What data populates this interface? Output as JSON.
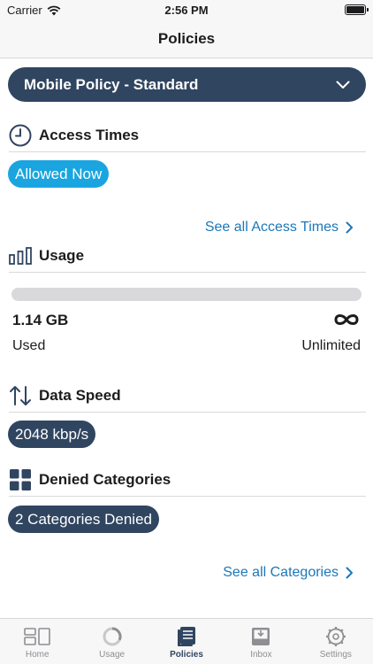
{
  "status": {
    "carrier": "Carrier",
    "time": "2:56 PM"
  },
  "nav": {
    "title": "Policies"
  },
  "policy": {
    "selected": "Mobile Policy - Standard"
  },
  "access_times": {
    "title": "Access Times",
    "status_badge": "Allowed Now",
    "link": "See all Access Times"
  },
  "usage": {
    "title": "Usage",
    "used_value": "1.14 GB",
    "used_label": "Used",
    "limit_label": "Unlimited"
  },
  "data_speed": {
    "title": "Data Speed",
    "value": "2048 kbp/s"
  },
  "denied": {
    "title": "Denied Categories",
    "badge": "2 Categories Denied",
    "link": "See all Categories"
  },
  "tabs": [
    {
      "label": "Home",
      "icon": "home-icon"
    },
    {
      "label": "Usage",
      "icon": "usage-ring-icon"
    },
    {
      "label": "Policies",
      "icon": "policies-icon"
    },
    {
      "label": "Inbox",
      "icon": "inbox-icon"
    },
    {
      "label": "Settings",
      "icon": "settings-gear-icon"
    }
  ],
  "colors": {
    "navy": "#304560",
    "cyan": "#1aa5e0",
    "link": "#1c77b8"
  }
}
